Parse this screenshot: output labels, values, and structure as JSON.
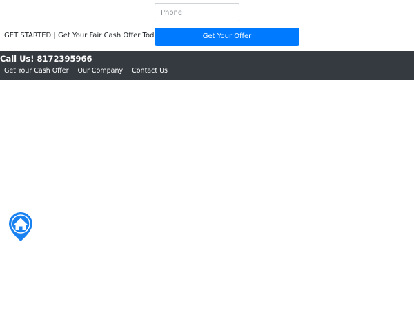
{
  "form": {
    "phone_placeholder": "Phone",
    "cta_text": "GET STARTED | Get Your Fair Cash Offer Today",
    "submit_label": "Get Your Offer"
  },
  "header": {
    "call_us": "Call Us! 8172395966",
    "nav": [
      {
        "label": "Get Your Cash Offer"
      },
      {
        "label": "Our Company"
      },
      {
        "label": "Contact Us"
      }
    ]
  },
  "icons": {
    "map_marker": "home-marker-icon"
  },
  "colors": {
    "accent": "#007bff",
    "topbar": "#343a40",
    "text": "#212529"
  }
}
